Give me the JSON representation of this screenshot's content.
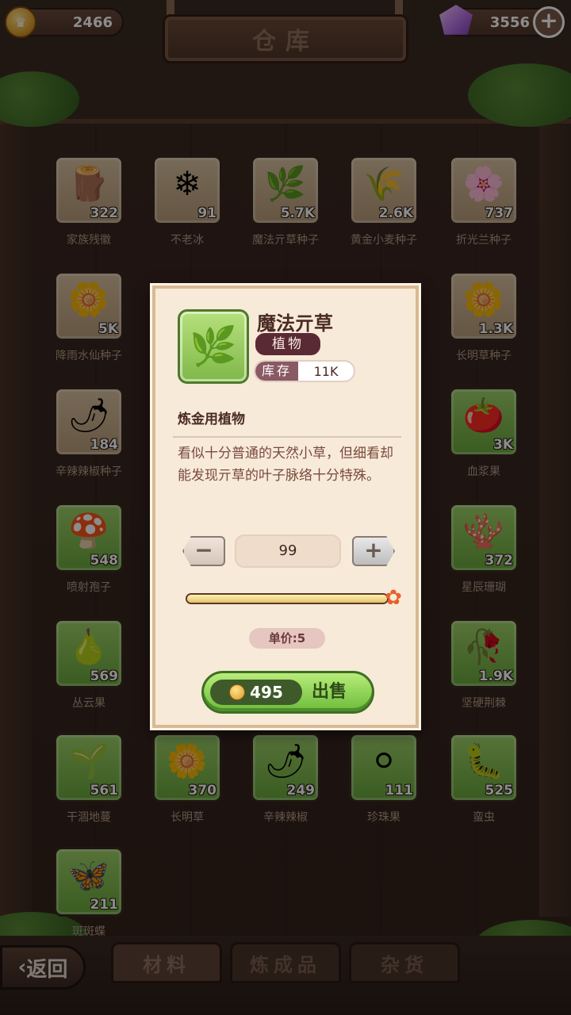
{
  "header": {
    "gold": "2466",
    "gems": "3556",
    "title": "仓库"
  },
  "grid": [
    {
      "name": "家族残徽",
      "count": "322",
      "glyph": "🪵",
      "bg": "brown"
    },
    {
      "name": "不老冰",
      "count": "91",
      "glyph": "❄",
      "bg": "brown"
    },
    {
      "name": "魔法亓草种子",
      "count": "5.7K",
      "glyph": "🌿",
      "bg": "brown"
    },
    {
      "name": "黄金小麦种子",
      "count": "2.6K",
      "glyph": "🌾",
      "bg": "brown"
    },
    {
      "name": "折光兰种子",
      "count": "737",
      "glyph": "🌸",
      "bg": "brown"
    },
    {
      "name": "降雨水仙种子",
      "count": "5K",
      "glyph": "🌼",
      "bg": "brown"
    },
    {
      "name": "长明草种子",
      "count": "1.3K",
      "glyph": "🌼",
      "bg": "brown"
    },
    {
      "name": "辛辣辣椒种子",
      "count": "184",
      "glyph": "🌶",
      "bg": "brown"
    },
    {
      "name": "血浆果",
      "count": "3K",
      "glyph": "🍅",
      "bg": "green"
    },
    {
      "name": "喷射孢子",
      "count": "548",
      "glyph": "🍄",
      "bg": "green"
    },
    {
      "name": "星辰珊瑚",
      "count": "372",
      "glyph": "🪸",
      "bg": "green"
    },
    {
      "name": "丛云果",
      "count": "569",
      "glyph": "🍐",
      "bg": "green"
    },
    {
      "name": "坚硬荆棘",
      "count": "1.9K",
      "glyph": "🥀",
      "bg": "green"
    },
    {
      "name": "干涸地蔓",
      "count": "561",
      "glyph": "🌱",
      "bg": "green"
    },
    {
      "name": "长明草",
      "count": "370",
      "glyph": "🌼",
      "bg": "green"
    },
    {
      "name": "辛辣辣椒",
      "count": "249",
      "glyph": "🌶",
      "bg": "green"
    },
    {
      "name": "珍珠果",
      "count": "111",
      "glyph": "⚪",
      "bg": "green"
    },
    {
      "name": "蛮虫",
      "count": "525",
      "glyph": "🐛",
      "bg": "green"
    },
    {
      "name": "斑斑蝶",
      "count": "211",
      "glyph": "🦋",
      "bg": "green"
    }
  ],
  "popup": {
    "name": "魔法亓草",
    "type": "植物",
    "stock_label": "库存",
    "stock_value": "11K",
    "subtitle": "炼金用植物",
    "description": "看似十分普通的天然小草，但细看却能发现亓草的叶子脉络十分特殊。",
    "icon": "herb-icon",
    "quantity": "99",
    "slider_fraction": 1.0,
    "unit_price": "单价:5",
    "total_price": "495",
    "sell_label": "出售"
  },
  "tabs": [
    {
      "label": "材料",
      "active": true
    },
    {
      "label": "炼成品",
      "active": false
    },
    {
      "label": "杂货",
      "active": false
    }
  ],
  "back_label": "返回",
  "colors": {
    "accent_green": "#6cbc3a",
    "panel_bg": "#f7ead8",
    "type_badge": "#5a2a34"
  }
}
